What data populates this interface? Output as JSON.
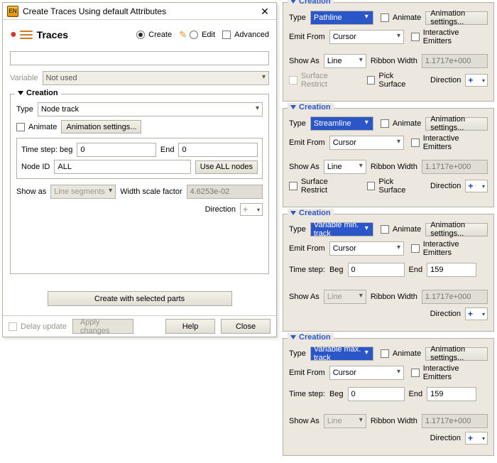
{
  "dialog": {
    "title": "Create Traces Using default Attributes",
    "traces_label": "Traces",
    "mode_create": "Create",
    "mode_edit": "Edit",
    "advanced": "Advanced",
    "variable_label": "Variable",
    "variable_value": "Not used",
    "creation_legend": "Creation",
    "type_label": "Type",
    "type_value": "Node track",
    "animate": "Animate",
    "anim_settings": "Animation settings...",
    "timestep_beg_label": "Time step: beg",
    "timestep_beg_value": "0",
    "end_label": "End",
    "end_value": "0",
    "nodeid_label": "Node ID",
    "nodeid_value": "ALL",
    "use_all_nodes": "Use ALL nodes",
    "show_as_label": "Show as",
    "show_as_value": "Line segments",
    "width_scale_label": "Width scale factor",
    "width_scale_value": "4.6253e-02",
    "direction_label": "Direction",
    "create_with_parts": "Create with selected parts",
    "delay_update": "Delay update",
    "apply_changes": "Apply changes",
    "help": "Help",
    "close": "Close"
  },
  "common": {
    "creation_legend": "Creation",
    "type_label": "Type",
    "animate": "Animate",
    "anim_settings": "Animation settings...",
    "emit_from_label": "Emit From",
    "emit_from_value": "Cursor",
    "interactive_emitters": "Interactive Emitters",
    "show_as_label": "Show As",
    "show_as_value": "Line",
    "ribbon_width_label": "Ribbon Width",
    "ribbon_width_value": "1.1717e+000",
    "surface_restrict": "Surface Restrict",
    "pick_surface": "Pick Surface",
    "direction_label": "Direction",
    "timestep_label": "Time step:",
    "beg_label": "Beg",
    "beg_value": "0",
    "end_label": "End",
    "end_value": "159"
  },
  "panels": [
    {
      "type_value": "Pathline"
    },
    {
      "type_value": "Streamline"
    },
    {
      "type_value": "Variable min. track"
    },
    {
      "type_value": "Variable max. track"
    }
  ]
}
